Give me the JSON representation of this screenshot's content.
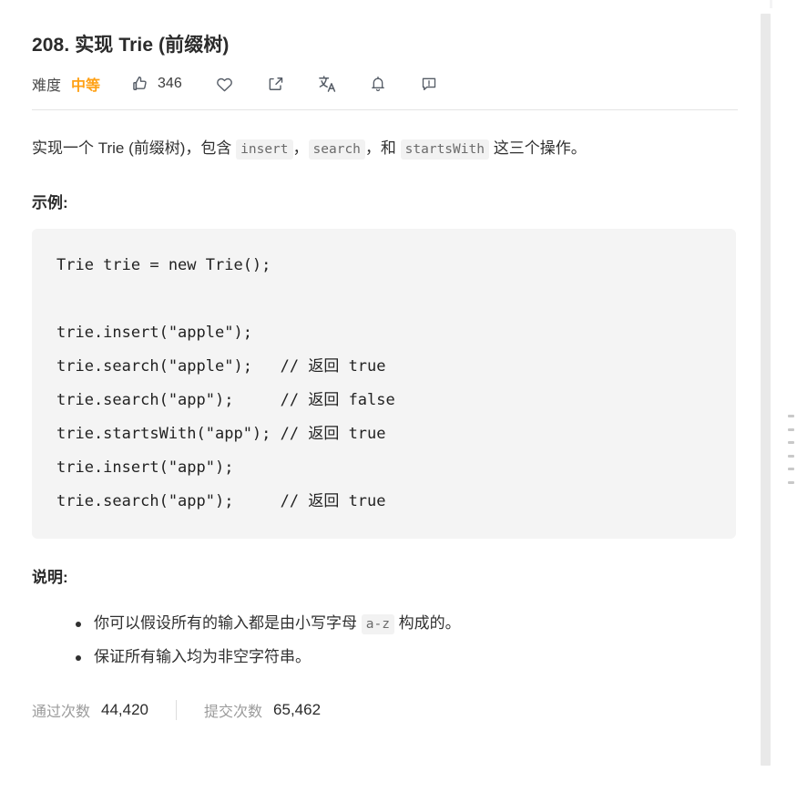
{
  "problem": {
    "title": "208. 实现 Trie (前缀树)",
    "difficulty_label": "难度",
    "difficulty_value": "中等",
    "difficulty_color": "#FFA116"
  },
  "toolbar": {
    "like": {
      "icon": "thumbs-up-icon",
      "count": "346"
    },
    "favorite": {
      "icon": "heart-icon"
    },
    "share": {
      "icon": "share-icon"
    },
    "translate": {
      "icon": "translate-icon"
    },
    "notify": {
      "icon": "bell-icon"
    },
    "report": {
      "icon": "report-icon"
    }
  },
  "description": {
    "text_before_1": "实现一个 Trie (前缀树)，包含 ",
    "code_1": "insert",
    "text_mid_1": "，",
    "code_2": "search",
    "text_mid_2": "，和 ",
    "code_3": "startsWith",
    "text_after": " 这三个操作。"
  },
  "example": {
    "heading": "示例:",
    "code": "Trie trie = new Trie();\n\ntrie.insert(\"apple\");\ntrie.search(\"apple\");   // 返回 true\ntrie.search(\"app\");     // 返回 false\ntrie.startsWith(\"app\"); // 返回 true\ntrie.insert(\"app\");\ntrie.search(\"app\");     // 返回 true"
  },
  "notes": {
    "heading": "说明:",
    "items": [
      {
        "before": "你可以假设所有的输入都是由小写字母 ",
        "code": "a-z",
        "after": " 构成的。"
      },
      {
        "before": "保证所有输入均为非空字符串。",
        "code": "",
        "after": ""
      }
    ]
  },
  "stats": {
    "accepted_label": "通过次数",
    "accepted_value": "44,420",
    "submissions_label": "提交次数",
    "submissions_value": "65,462"
  }
}
